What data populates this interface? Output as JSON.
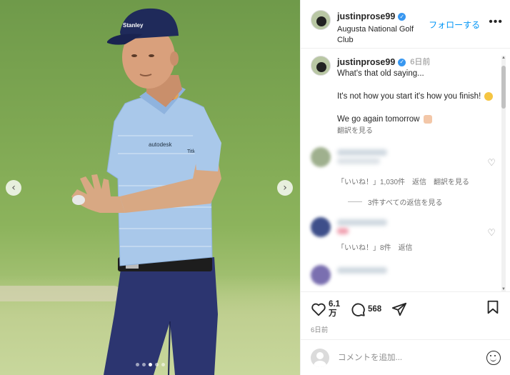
{
  "header": {
    "username": "justinprose99",
    "location": "Augusta National Golf Club",
    "follow_label": "フォローする",
    "more_label": "•••"
  },
  "caption": {
    "username": "justinprose99",
    "time": "6日前",
    "text": "What's that old saying...\n\nIt's not how you start it's how you finish! \n\nWe go again tomorrow ",
    "translate_label": "翻訳を見る"
  },
  "comments": [
    {
      "meta": [
        "「いいね！」1,030件",
        "返信",
        "翻訳を見る"
      ],
      "replies_label": "3件すべての返信を見る",
      "avatar_color": "#9fb08e"
    },
    {
      "meta": [
        "「いいね！」8件",
        "返信"
      ],
      "avatar_color": "#3e4f8a"
    },
    {
      "avatar_color": "#7a6fb0"
    }
  ],
  "actions": {
    "like_count_line1": "6.1",
    "like_count_line2": "万",
    "comment_count": "568",
    "timestamp": "6日前"
  },
  "compose": {
    "placeholder": "コメントを追加..."
  },
  "media": {
    "total_slides": 5,
    "active_slide": 2
  }
}
